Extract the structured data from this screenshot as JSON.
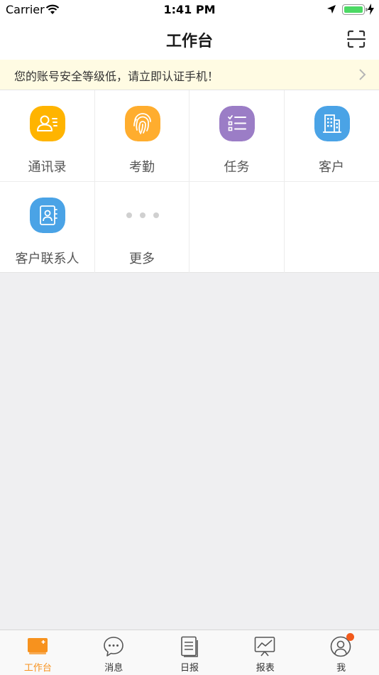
{
  "status_bar": {
    "carrier": "Carrier",
    "time": "1:41 PM"
  },
  "nav": {
    "title": "工作台",
    "scan_icon": "scan-icon"
  },
  "notice": {
    "text": "您的账号安全等级低，请立即认证手机！"
  },
  "grid": {
    "items": [
      {
        "label": "通讯录",
        "icon": "contacts-icon",
        "color": "#ffb400"
      },
      {
        "label": "考勤",
        "icon": "fingerprint-icon",
        "color": "#ffad2e"
      },
      {
        "label": "任务",
        "icon": "task-list-icon",
        "color": "#9b7dc6"
      },
      {
        "label": "客户",
        "icon": "building-icon",
        "color": "#4aa3e6"
      },
      {
        "label": "客户联系人",
        "icon": "contact-book-icon",
        "color": "#4aa3e6"
      },
      {
        "label": "更多",
        "icon": "more-dots-icon",
        "color": "#d0d0d0"
      }
    ]
  },
  "tabs": [
    {
      "label": "工作台",
      "icon": "workbench-icon",
      "active": true
    },
    {
      "label": "消息",
      "icon": "message-icon",
      "active": false
    },
    {
      "label": "日报",
      "icon": "daily-report-icon",
      "active": false
    },
    {
      "label": "报表",
      "icon": "chart-report-icon",
      "active": false
    },
    {
      "label": "我",
      "icon": "profile-icon",
      "active": false,
      "badge": true
    }
  ],
  "colors": {
    "accent": "#f7921e",
    "badge": "#f25a1c",
    "notice_bg": "#fffbe3"
  }
}
